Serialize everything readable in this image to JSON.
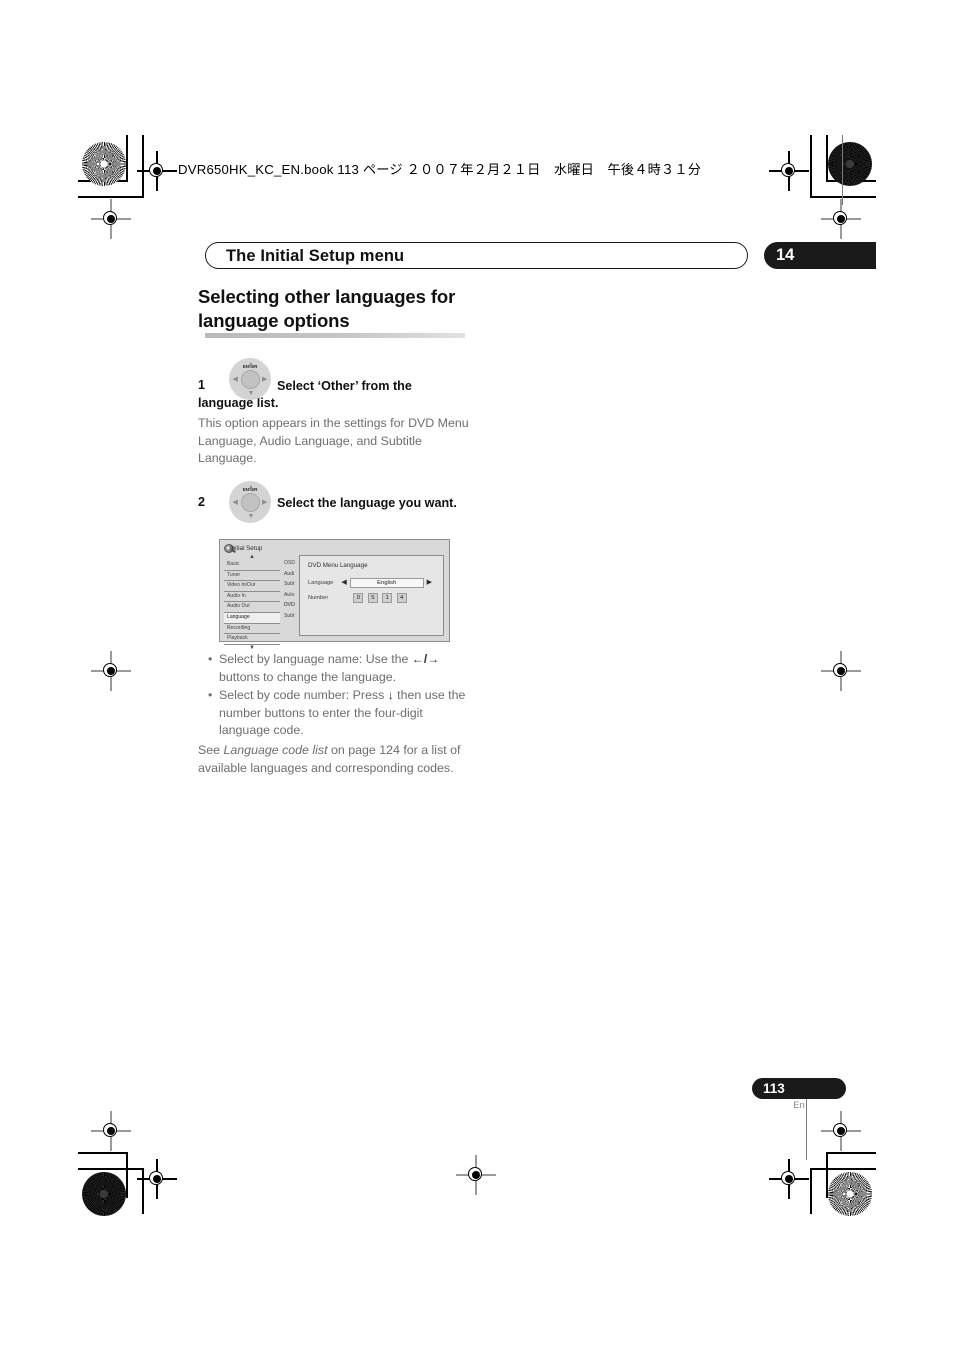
{
  "runhead": "DVR650HK_KC_EN.book  113 ページ  ２００７年２月２１日　水曜日　午後４時３１分",
  "chapter": {
    "title": "The Initial Setup menu",
    "number": "14"
  },
  "section": {
    "heading": "Selecting other languages for language options"
  },
  "steps": [
    {
      "num": "1",
      "bold": "Select ‘Other’ from the language list.",
      "body": "This option appears in the settings for DVD Menu Language, Audio Language, and Subtitle Language.",
      "icon": "remote-nav-button"
    },
    {
      "num": "2",
      "bold": "Select the language you want.",
      "icon": "remote-nav-button"
    }
  ],
  "nav_button": {
    "center_label": "ENTER",
    "up": "▲",
    "down": "▼",
    "left": "◀",
    "right": "▶"
  },
  "osd": {
    "title": "Initial Setup",
    "scroll_up": "▲",
    "scroll_down": "▼",
    "sidebar": [
      "Basic",
      "Tuner",
      "Video In/Out",
      "Audio In",
      "Audio Out",
      "Language",
      "Recording",
      "Playback"
    ],
    "sidebar_selected": "Language",
    "midcolumn": [
      "OSD",
      "Audi",
      "Subt",
      "Auto",
      "DVD",
      "Subt"
    ],
    "midcolumn_selected": "DVD",
    "panel": {
      "title": "DVD Menu Language",
      "language_label": "Language",
      "language_value": "English",
      "left_arrow": "◀",
      "right_arrow": "▶",
      "number_label": "Number",
      "number_digits": [
        "0",
        "5",
        "1",
        "4"
      ]
    }
  },
  "bullets": [
    {
      "pre": "Select by language name: Use the ",
      "glyph": "←/→",
      "post": " buttons to change the language."
    },
    {
      "pre": "Select by code number: Press ",
      "glyph": "↓",
      "post": " then use the number buttons to enter the four-digit language code."
    }
  ],
  "see_note": {
    "pre": "See ",
    "italic": "Language code list",
    "post": " on page 124 for a list of available languages and corresponding codes."
  },
  "footer": {
    "page_number": "113",
    "language_code": "En"
  }
}
